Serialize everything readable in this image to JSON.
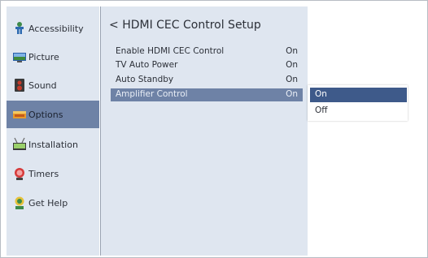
{
  "sidebar": {
    "items": [
      {
        "label": "Accessibility",
        "icon": "accessibility-icon"
      },
      {
        "label": "Picture",
        "icon": "picture-icon"
      },
      {
        "label": "Sound",
        "icon": "sound-icon"
      },
      {
        "label": "Options",
        "icon": "options-icon",
        "selected": true
      },
      {
        "label": "Installation",
        "icon": "installation-icon"
      },
      {
        "label": "Timers",
        "icon": "timers-icon"
      },
      {
        "label": "Get Help",
        "icon": "get-help-icon"
      }
    ]
  },
  "main": {
    "back_glyph": "<",
    "title": "HDMI CEC Control Setup",
    "rows": [
      {
        "label": "Enable HDMI CEC Control",
        "value": "On"
      },
      {
        "label": "TV Auto Power",
        "value": "On"
      },
      {
        "label": "Auto Standby",
        "value": "On"
      },
      {
        "label": "Amplifier Control",
        "value": "On",
        "selected": true
      }
    ]
  },
  "dropdown": {
    "options": [
      {
        "label": "On",
        "selected": true
      },
      {
        "label": "Off"
      }
    ]
  },
  "colors": {
    "panel_bg": "#dfe6f0",
    "highlight": "#6e82a6",
    "dropdown_highlight": "#3e5a8a"
  }
}
